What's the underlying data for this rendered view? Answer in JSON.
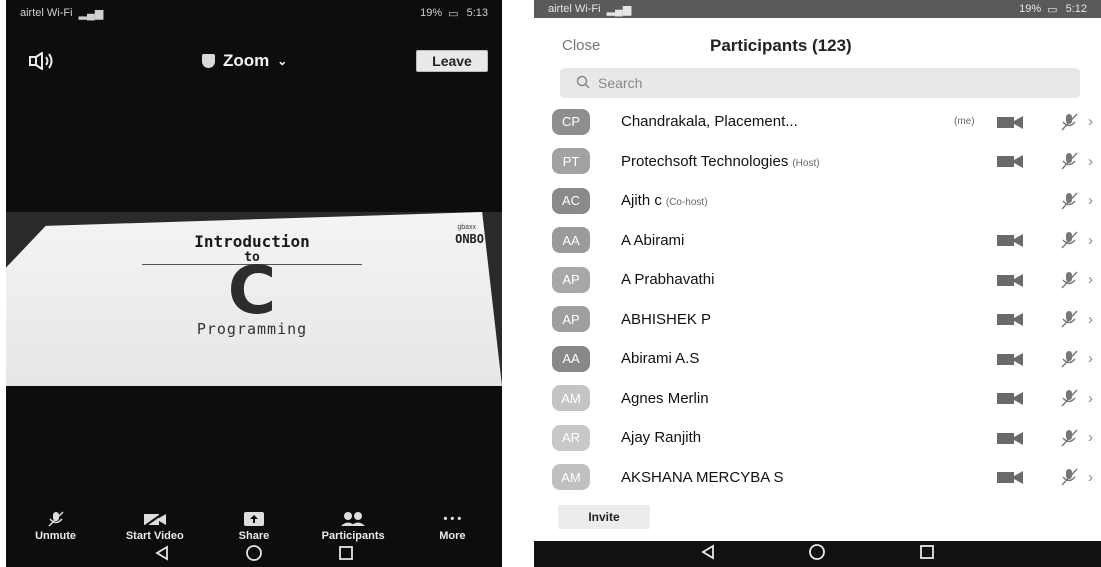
{
  "left_screen": {
    "status": {
      "carrier": "airtel Wi-Fi",
      "battery": "19%",
      "time": "5:13"
    },
    "header": {
      "title": "Zoom",
      "leave_label": "Leave"
    },
    "slide": {
      "brand_small": "gbaxx",
      "brand": "ONBO",
      "title": "Introduction",
      "to": "to",
      "letter": "C",
      "subtitle": "Programming"
    },
    "toolbar": [
      {
        "label": "Unmute",
        "icon": "muted-mic-icon"
      },
      {
        "label": "Start Video",
        "icon": "video-off-icon"
      },
      {
        "label": "Share",
        "icon": "share-icon"
      },
      {
        "label": "Participants",
        "icon": "participants-icon"
      },
      {
        "label": "More",
        "icon": "more-dots-icon"
      }
    ]
  },
  "right_screen": {
    "status": {
      "carrier": "airtel Wi-Fi",
      "battery": "19%",
      "time": "5:12"
    },
    "header": {
      "close_label": "Close",
      "title": "Participants (123)"
    },
    "search": {
      "placeholder": "Search"
    },
    "participants": [
      {
        "initials": "CP",
        "name": "Chandrakala, Placement...",
        "tag": "",
        "me": "(me)",
        "video": true,
        "avatar_color": "#8e8e8e"
      },
      {
        "initials": "PT",
        "name": "Protechsoft Technologies",
        "tag": "(Host)",
        "me": "",
        "video": true,
        "avatar_color": "#a2a2a2"
      },
      {
        "initials": "AC",
        "name": "Ajith c",
        "tag": "(Co-host)",
        "me": "",
        "video": false,
        "avatar_color": "#8a8a8a"
      },
      {
        "initials": "AA",
        "name": "A Abirami",
        "tag": "",
        "me": "",
        "video": true,
        "avatar_color": "#9a9a9a"
      },
      {
        "initials": "AP",
        "name": "A Prabhavathi",
        "tag": "",
        "me": "",
        "video": true,
        "avatar_color": "#a8a8a8"
      },
      {
        "initials": "AP",
        "name": "ABHISHEK P",
        "tag": "",
        "me": "",
        "video": true,
        "avatar_color": "#9e9e9e"
      },
      {
        "initials": "AA",
        "name": "Abirami A.S",
        "tag": "",
        "me": "",
        "video": true,
        "avatar_color": "#888888"
      },
      {
        "initials": "AM",
        "name": "Agnes Merlin",
        "tag": "",
        "me": "",
        "video": true,
        "avatar_color": "#c4c4c4"
      },
      {
        "initials": "AR",
        "name": "Ajay Ranjith",
        "tag": "",
        "me": "",
        "video": true,
        "avatar_color": "#c8c8c8"
      },
      {
        "initials": "AM",
        "name": "AKSHANA MERCYBA S",
        "tag": "",
        "me": "",
        "video": true,
        "avatar_color": "#c0c0c0"
      }
    ],
    "invite_label": "Invite"
  }
}
